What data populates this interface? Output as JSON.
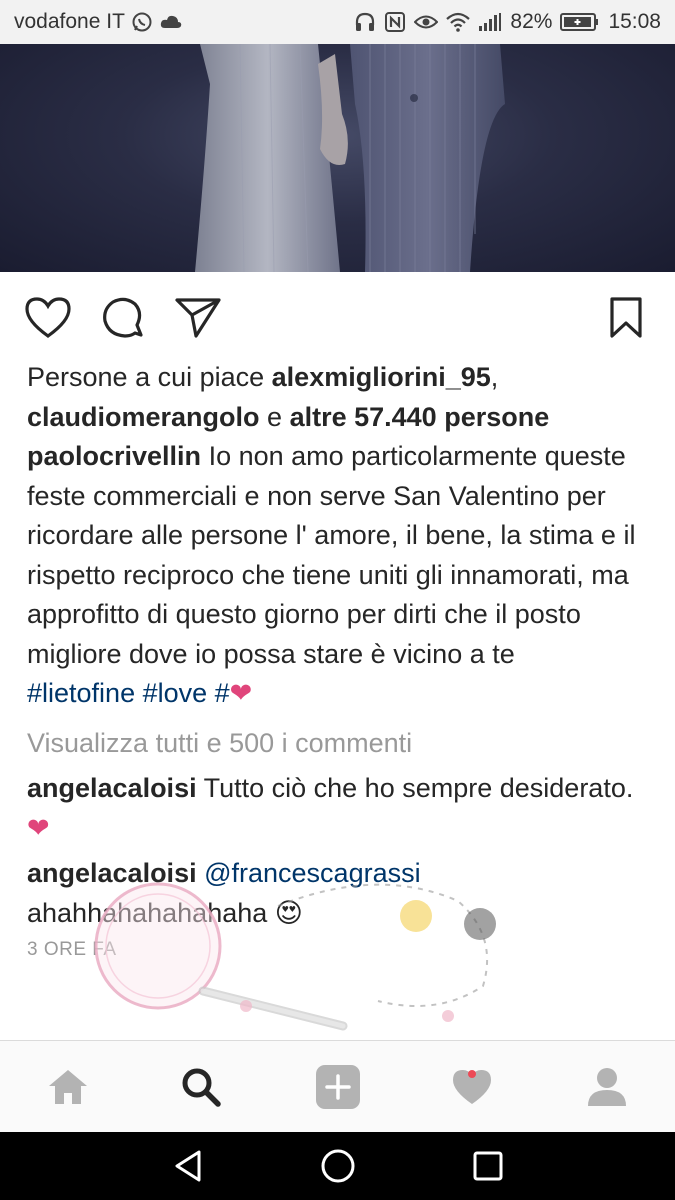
{
  "status_bar": {
    "carrier": "vodafone IT",
    "battery_percent": "82%",
    "time": "15:08",
    "icons": [
      "whatsapp-icon",
      "cloud-icon",
      "headphones-icon",
      "nfc-icon",
      "eye-icon",
      "wifi-icon",
      "signal-icon",
      "battery-icon"
    ]
  },
  "post": {
    "likes": {
      "prefix": "Persone a cui piace ",
      "user1": "alexmigliorini_95",
      "separator": ",",
      "user2": "claudiomerangolo",
      "conjunction": " e ",
      "others": "altre 57.440 persone"
    },
    "caption": {
      "username": "paolocrivellin",
      "text": " Io non amo particolarmente queste feste commerciali e non serve San Valentino per ricordare alle persone l' amore, il bene, la stima e il rispetto reciproco che tiene uniti gli innamorati, ma approfitto di questo giorno per dirti che il posto migliore dove io possa stare è vicino a te",
      "hashtags": "#lietofine #love #",
      "heart": "❤"
    },
    "view_all_comments": "Visualizza tutti e 500 i commenti",
    "comments": [
      {
        "username": "angelacaloisi",
        "text": " Tutto ciò che ho sempre desiderato. ",
        "emoji": "❤"
      },
      {
        "username": "angelacaloisi",
        "mention": "@francescagrassi",
        "text": " ahahhahahahahaha ",
        "emoji": "😍"
      }
    ],
    "timestamp": "3 ORE FA"
  },
  "actions": [
    "heart-icon",
    "comment-icon",
    "share-icon",
    "bookmark-icon"
  ],
  "bottom_nav": [
    "home-icon",
    "search-icon",
    "add-icon",
    "activity-icon",
    "profile-icon"
  ],
  "system_nav": [
    "back-icon",
    "home-circle-icon",
    "recents-icon"
  ],
  "colors": {
    "link": "#003569",
    "muted": "#999999",
    "text": "#262626",
    "heart": "#e0457b",
    "notif": "#ed4956"
  }
}
